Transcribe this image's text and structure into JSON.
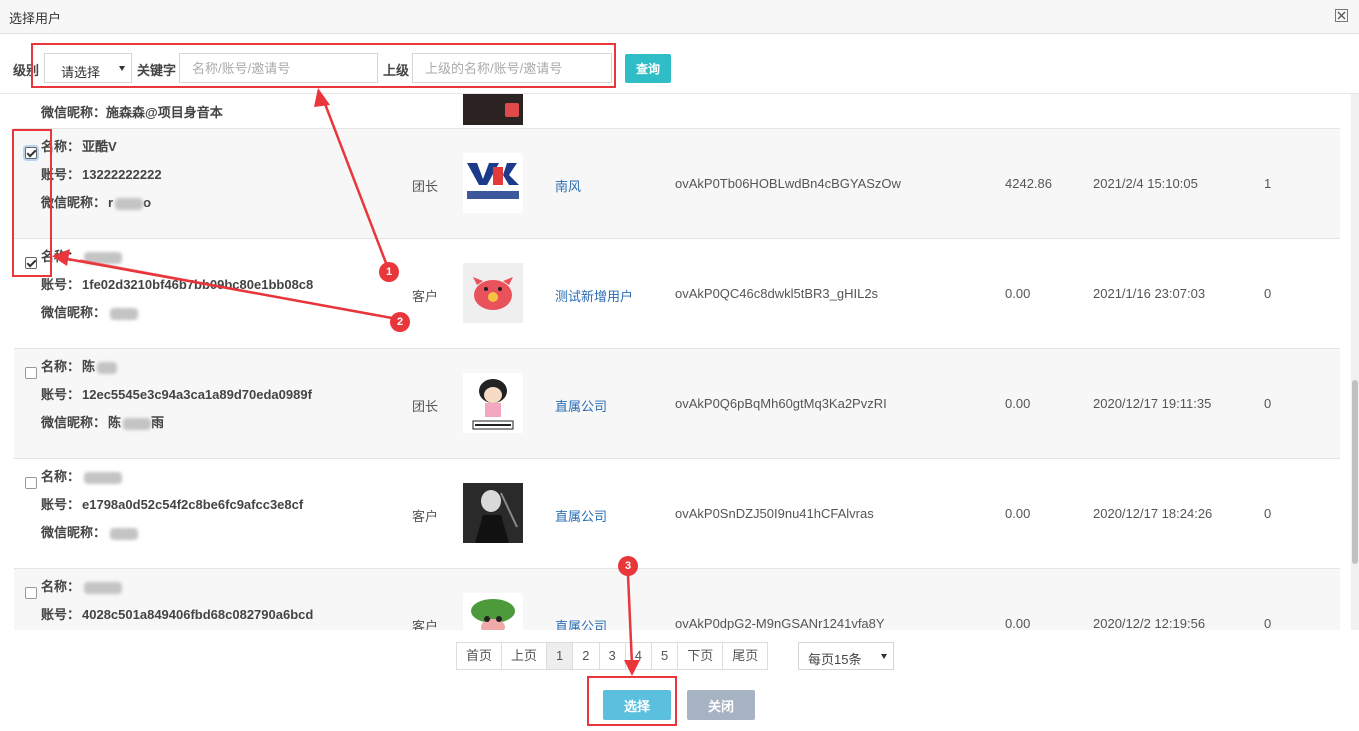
{
  "dialog": {
    "title": "选择用户"
  },
  "search": {
    "level_label": "级别",
    "level_value": "请选择",
    "keyword_label": "关键字",
    "keyword_placeholder": "名称/账号/邀请号",
    "parent_label": "上级",
    "parent_placeholder": "上级的名称/账号/邀请号",
    "query_label": "查询"
  },
  "field_labels": {
    "name": "名称：",
    "account": "账号：",
    "wechat": "微信昵称："
  },
  "partial_row": {
    "wechat_text": "施森森@项目身音本"
  },
  "rows": [
    {
      "checked": true,
      "name": "亚酷V",
      "account": "13222222222",
      "wechat": "r",
      "wechat_tail": "o",
      "role": "团长",
      "avatar": "yarkool-logo",
      "parent": "南风",
      "openid": "ovAkP0Tb06HOBLwdBn4cBGYASzOw",
      "balance": "4242.86",
      "time": "2021/2/4 15:10:05",
      "count": "1"
    },
    {
      "checked": true,
      "name": "",
      "account": "1fe02d3210bf46b7bb09bc80e1bb08c8",
      "wechat": "",
      "wechat_tail": "",
      "role": "客户",
      "avatar": "pink-pig-avatar",
      "parent": "测试新增用户",
      "openid": "ovAkP0QC46c8dwkl5tBR3_gHIL2s",
      "balance": "0.00",
      "time": "2021/1/16 23:07:03",
      "count": "0"
    },
    {
      "checked": false,
      "name": "陈",
      "account": "12ec5545e3c94a3ca1a89d70eda0989f",
      "wechat": "陈",
      "wechat_tail": "雨",
      "role": "团长",
      "avatar": "cartoon-girl-avatar",
      "parent": "直属公司",
      "openid": "ovAkP0Q6pBqMh60gtMq3Ka2PvzRI",
      "balance": "0.00",
      "time": "2020/12/17 19:11:35",
      "count": "0"
    },
    {
      "checked": false,
      "name": "",
      "account": "e1798a0d52c54f2c8be6fc9afcc3e8cf",
      "wechat": "",
      "wechat_tail": "",
      "role": "客户",
      "avatar": "dark-photo-avatar",
      "parent": "直属公司",
      "openid": "ovAkP0SnDZJ50I9nu41hCFAlvras",
      "balance": "0.00",
      "time": "2020/12/17 18:24:26",
      "count": "0"
    },
    {
      "checked": false,
      "name": "",
      "account": "4028c501a849406fbd68c082790a6bcd",
      "wechat": "",
      "wechat_tail": "",
      "role": "客户",
      "avatar": "green-cartoon-avatar",
      "parent": "直属公司",
      "openid": "ovAkP0dpG2-M9nGSANr1241vfa8Y",
      "balance": "0.00",
      "time": "2020/12/2 12:19:56",
      "count": "0"
    }
  ],
  "pagination": {
    "first": "首页",
    "prev": "上页",
    "pages": [
      "1",
      "2",
      "3",
      "4",
      "5"
    ],
    "current": "1",
    "next": "下页",
    "last": "尾页",
    "per_page": "每页15条"
  },
  "actions": {
    "select_label": "选择",
    "close_label": "关闭"
  },
  "annotations": {
    "badge1": "1",
    "badge2": "2",
    "badge3": "3",
    "color": "#e8363b"
  },
  "theme": {
    "query_button": "#2fbec7",
    "select_button": "#5bc0de",
    "close_button": "#a7b3c3",
    "link": "#2a6db4"
  }
}
